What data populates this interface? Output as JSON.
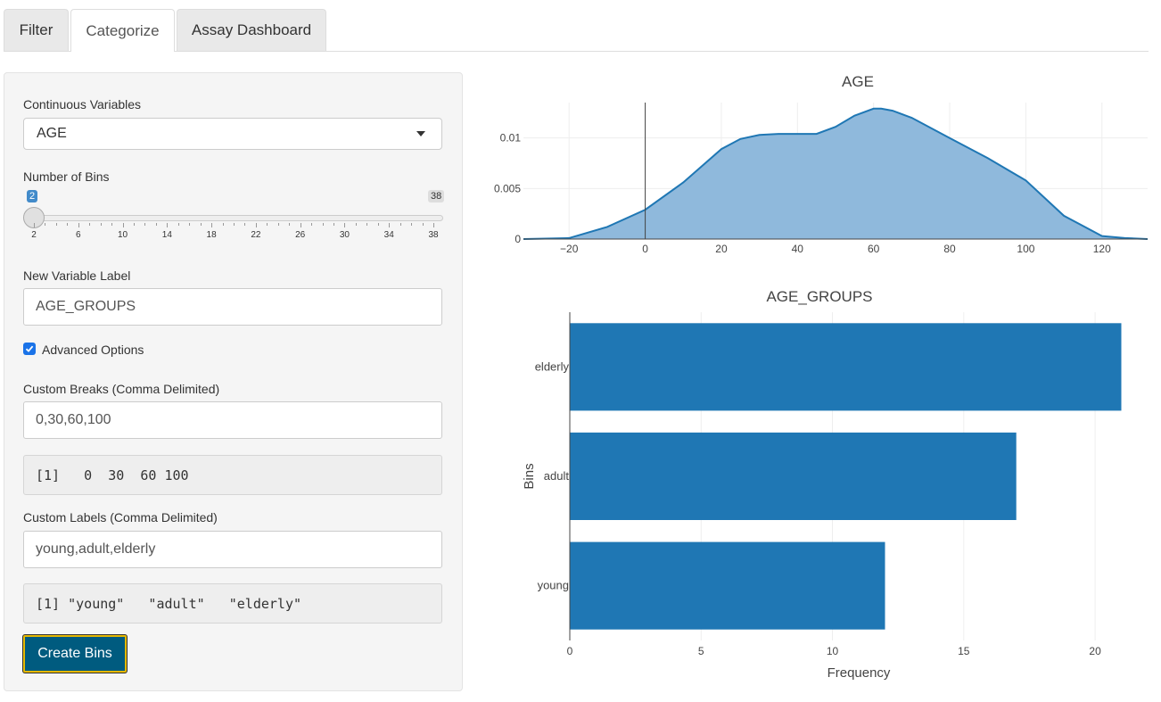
{
  "tabs": [
    "Filter",
    "Categorize",
    "Assay Dashboard"
  ],
  "active_tab": "Categorize",
  "sidebar": {
    "continuous_label": "Continuous Variables",
    "continuous_value": "AGE",
    "bins_label": "Number of Bins",
    "bins_min": "2",
    "bins_max": "38",
    "bins_value": 2,
    "bins_ticks": [
      "2",
      "6",
      "10",
      "14",
      "18",
      "22",
      "26",
      "30",
      "34",
      "38"
    ],
    "new_var_label": "New Variable Label",
    "new_var_value": "AGE_GROUPS",
    "advanced_label": "Advanced Options",
    "advanced_checked": true,
    "breaks_label": "Custom Breaks (Comma Delimited)",
    "breaks_value": "0,30,60,100",
    "breaks_output": "[1]   0  30  60 100",
    "labels_label": "Custom Labels (Comma Delimited)",
    "labels_value": "young,adult,elderly",
    "labels_output": "[1] \"young\"   \"adult\"   \"elderly\"",
    "create_button": "Create Bins"
  },
  "colors": {
    "density_fill": "#8fb9dc",
    "density_line": "#1f77b4",
    "bar_fill": "#1f77b4",
    "button_bg": "#005b7f",
    "button_border": "#e6b800"
  },
  "chart_data": [
    {
      "type": "area",
      "title": "AGE",
      "xlabel": "",
      "ylabel": "",
      "xlim": [
        -32,
        132
      ],
      "ylim": [
        0,
        0.0135
      ],
      "x_ticks": [
        -20,
        0,
        20,
        40,
        60,
        80,
        100,
        120
      ],
      "x_tick_labels": [
        "−20",
        "0",
        "20",
        "40",
        "60",
        "80",
        "100",
        "120"
      ],
      "y_ticks": [
        0,
        0.005,
        0.01
      ],
      "y_tick_labels": [
        "0",
        "0.005",
        "0.01"
      ],
      "x": [
        -32,
        -20,
        -10,
        0,
        10,
        20,
        25,
        30,
        35,
        40,
        45,
        50,
        55,
        60,
        62,
        65,
        70,
        80,
        90,
        100,
        110,
        120,
        126,
        132
      ],
      "y": [
        0,
        0.0001,
        0.0012,
        0.0029,
        0.0056,
        0.0089,
        0.0099,
        0.0103,
        0.0104,
        0.0104,
        0.0104,
        0.0111,
        0.0122,
        0.0129,
        0.0129,
        0.0127,
        0.012,
        0.01,
        0.008,
        0.0058,
        0.0023,
        0.0003,
        0.0001,
        0
      ],
      "grid": true
    },
    {
      "type": "bar",
      "orientation": "horizontal",
      "title": "AGE_GROUPS",
      "xlabel": "Frequency",
      "ylabel": "Bins",
      "categories": [
        "young",
        "adult",
        "elderly"
      ],
      "values": [
        12,
        17,
        21
      ],
      "xlim": [
        0,
        22
      ],
      "x_ticks": [
        0,
        5,
        10,
        15,
        20
      ],
      "grid": true
    }
  ]
}
